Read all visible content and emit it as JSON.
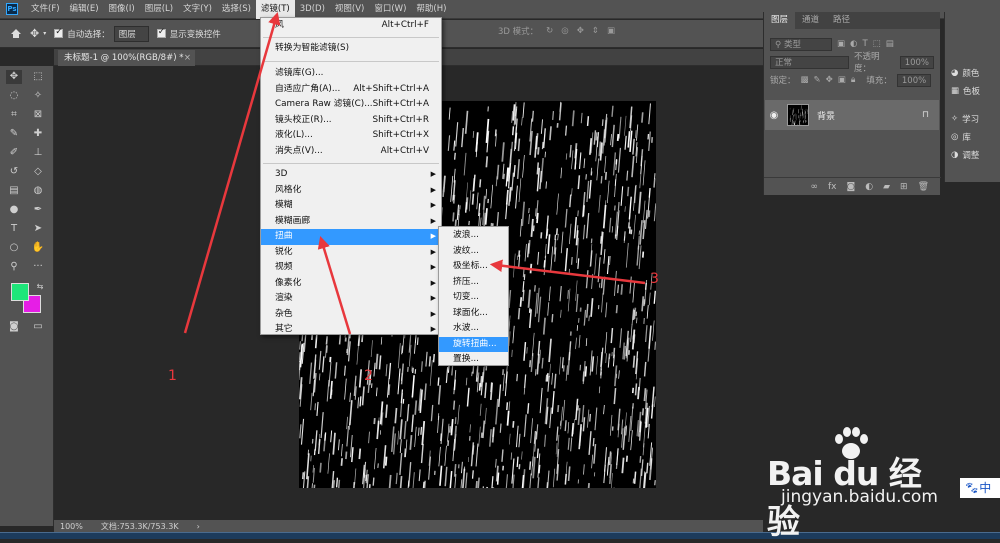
{
  "app": {
    "logo": "Ps"
  },
  "menubar": {
    "items": [
      "文件(F)",
      "编辑(E)",
      "图像(I)",
      "图层(L)",
      "文字(Y)",
      "选择(S)",
      "滤镜(T)",
      "3D(D)",
      "视图(V)",
      "窗口(W)",
      "帮助(H)"
    ],
    "active": "滤镜(T)"
  },
  "options": {
    "auto_select_label": "自动选择：",
    "auto_select_value": "图层",
    "show_transform_label": "显示变换控件",
    "mode_3d_label": "3D 模式："
  },
  "document_tab": {
    "title": "未标题-1 @ 100%(RGB/8#) *",
    "close": "×"
  },
  "statusbar": {
    "zoom": "100%",
    "doc_info": "文档:753.3K/753.3K",
    "arrow": "›"
  },
  "filter_menu": {
    "groups": [
      [
        {
          "label": "风",
          "shortcut": "Alt+Ctrl+F"
        }
      ],
      [
        {
          "label": "转换为智能滤镜(S)",
          "shortcut": ""
        }
      ],
      [
        {
          "label": "滤镜库(G)...",
          "shortcut": ""
        },
        {
          "label": "自适应广角(A)...",
          "shortcut": "Alt+Shift+Ctrl+A"
        },
        {
          "label": "Camera Raw 滤镜(C)...",
          "shortcut": "Shift+Ctrl+A"
        },
        {
          "label": "镜头校正(R)...",
          "shortcut": "Shift+Ctrl+R"
        },
        {
          "label": "液化(L)...",
          "shortcut": "Shift+Ctrl+X"
        },
        {
          "label": "消失点(V)...",
          "shortcut": "Alt+Ctrl+V"
        }
      ],
      [
        {
          "label": "3D",
          "submenu": true
        },
        {
          "label": "风格化",
          "submenu": true
        },
        {
          "label": "模糊",
          "submenu": true
        },
        {
          "label": "模糊画廊",
          "submenu": true
        },
        {
          "label": "扭曲",
          "submenu": true,
          "highlighted": true
        },
        {
          "label": "锐化",
          "submenu": true
        },
        {
          "label": "视频",
          "submenu": true
        },
        {
          "label": "像素化",
          "submenu": true
        },
        {
          "label": "渲染",
          "submenu": true
        },
        {
          "label": "杂色",
          "submenu": true
        },
        {
          "label": "其它",
          "submenu": true
        }
      ]
    ],
    "arrow": "▶"
  },
  "distort_submenu": {
    "items": [
      {
        "label": "波浪..."
      },
      {
        "label": "波纹..."
      },
      {
        "label": "极坐标..."
      },
      {
        "label": "挤压..."
      },
      {
        "label": "切变..."
      },
      {
        "label": "球面化..."
      },
      {
        "label": "水波..."
      },
      {
        "label": "旋转扭曲...",
        "highlighted": true
      },
      {
        "label": "置换..."
      }
    ]
  },
  "layers_panel": {
    "tabs": [
      "图层",
      "通道",
      "路径"
    ],
    "active_tab": "图层",
    "kind_filter": "类型",
    "blend_mode": "正常",
    "opacity_label": "不透明度：",
    "opacity_value": "100%",
    "lock_label": "锁定：",
    "fill_label": "填充：",
    "fill_value": "100%",
    "layers": [
      {
        "name": "背景",
        "visible": true,
        "locked": true
      }
    ]
  },
  "right_dock": {
    "items": [
      "颜色",
      "色板",
      "学习",
      "库",
      "调整"
    ]
  },
  "colors": {
    "foreground": "#1ee67a",
    "background": "#e61ee6",
    "accent": "#3399ff",
    "annotation": "#e8383d"
  },
  "annotations": {
    "labels": [
      "1",
      "2",
      "3"
    ]
  },
  "watermark": {
    "brand": "Bai du 经验",
    "url": "jingyan.baidu.com"
  },
  "ime": {
    "label": "中"
  }
}
